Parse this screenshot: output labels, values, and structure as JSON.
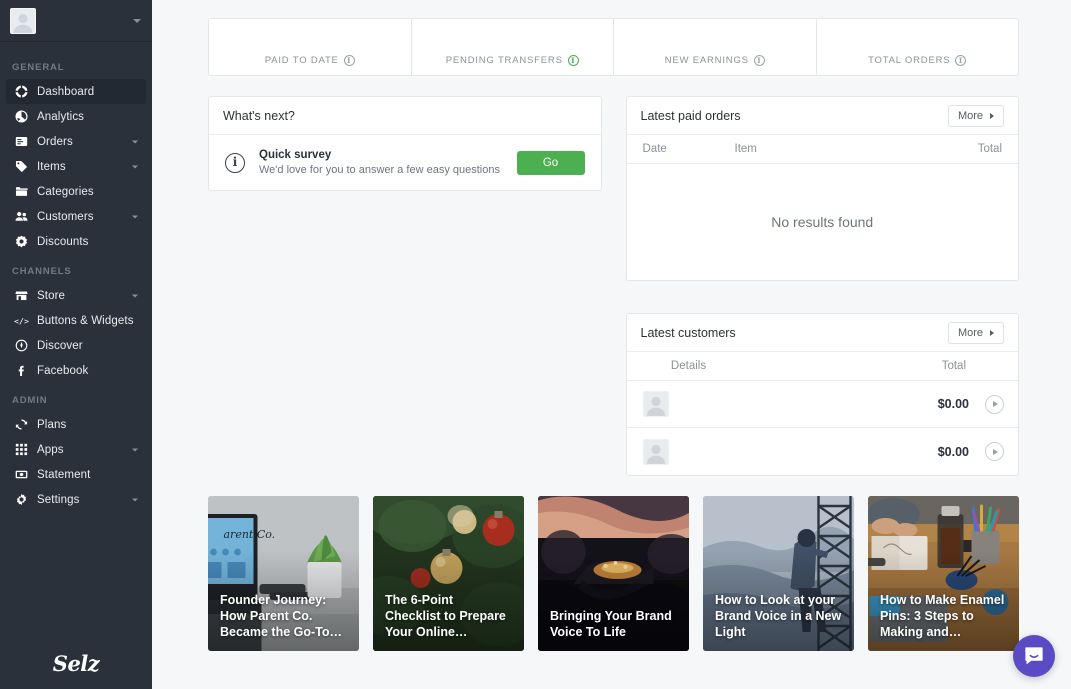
{
  "sidebar": {
    "account": {
      "avatar_alt": "user-avatar",
      "caret": "chevron-down-icon"
    },
    "logo": "Selz",
    "groups": [
      {
        "label": "GENERAL",
        "items": [
          {
            "label": "Dashboard",
            "icon": "dashboard-icon",
            "active": true,
            "expandable": false
          },
          {
            "label": "Analytics",
            "icon": "analytics-icon",
            "active": false,
            "expandable": false
          },
          {
            "label": "Orders",
            "icon": "orders-icon",
            "active": false,
            "expandable": true
          },
          {
            "label": "Items",
            "icon": "tag-icon",
            "active": false,
            "expandable": true
          },
          {
            "label": "Categories",
            "icon": "folder-icon",
            "active": false,
            "expandable": false
          },
          {
            "label": "Customers",
            "icon": "customers-icon",
            "active": false,
            "expandable": true
          },
          {
            "label": "Discounts",
            "icon": "discount-icon",
            "active": false,
            "expandable": false
          }
        ]
      },
      {
        "label": "CHANNELS",
        "items": [
          {
            "label": "Store",
            "icon": "store-icon",
            "active": false,
            "expandable": true
          },
          {
            "label": "Buttons & Widgets",
            "icon": "code-icon",
            "active": false,
            "expandable": false
          },
          {
            "label": "Discover",
            "icon": "discover-icon",
            "active": false,
            "expandable": false
          },
          {
            "label": "Facebook",
            "icon": "facebook-icon",
            "active": false,
            "expandable": false
          }
        ]
      },
      {
        "label": "ADMIN",
        "items": [
          {
            "label": "Plans",
            "icon": "plans-icon",
            "active": false,
            "expandable": false
          },
          {
            "label": "Apps",
            "icon": "apps-icon",
            "active": false,
            "expandable": true
          },
          {
            "label": "Statement",
            "icon": "statement-icon",
            "active": false,
            "expandable": false
          },
          {
            "label": "Settings",
            "icon": "gear-icon",
            "active": false,
            "expandable": true
          }
        ]
      }
    ]
  },
  "stats": [
    {
      "label": "PAID TO DATE",
      "value": "",
      "info_icon": "info-icon",
      "info_color": "#9aa3ad"
    },
    {
      "label": "PENDING TRANSFERS",
      "value": "",
      "info_icon": "info-icon",
      "info_color": "#4caf50"
    },
    {
      "label": "NEW EARNINGS",
      "value": "",
      "info_icon": "info-icon",
      "info_color": "#9aa3ad"
    },
    {
      "label": "TOTAL ORDERS",
      "value": "",
      "info_icon": "info-icon",
      "info_color": "#9aa3ad"
    }
  ],
  "whats_next": {
    "title": "What's next?",
    "task": {
      "icon": "info-icon",
      "title": "Quick survey",
      "subtitle": "We'd love for you to answer a few easy questions",
      "action_label": "Go"
    }
  },
  "latest_paid_orders": {
    "title": "Latest paid orders",
    "more_label": "More",
    "columns": {
      "date": "Date",
      "item": "Item",
      "total": "Total"
    },
    "empty_text": "No results found",
    "rows": []
  },
  "latest_customers": {
    "title": "Latest customers",
    "more_label": "More",
    "columns": {
      "details": "Details",
      "total": "Total"
    },
    "rows": [
      {
        "avatar": "user-avatar-placeholder",
        "name": "",
        "total": "$0.00",
        "chevron": "chevron-right-icon"
      },
      {
        "avatar": "user-avatar-placeholder",
        "name": "",
        "total": "$0.00",
        "chevron": "chevron-right-icon"
      }
    ]
  },
  "blog_posts": [
    {
      "title": "Founder Journey: How Parent Co. Became the Go-To…",
      "theme": "desk-laptop-plant"
    },
    {
      "title": "The 6-Point Checklist to Prepare Your Online…",
      "theme": "christmas-ornaments"
    },
    {
      "title": "Bringing Your Brand Voice To Life",
      "theme": "dark-sunset-hands"
    },
    {
      "title": "How to Look at your Brand Voice in a New Light",
      "theme": "tower-person-fog"
    },
    {
      "title": "How to Make Enamel Pins: 3 Steps to Making and…",
      "theme": "desk-coffee-pens"
    }
  ],
  "intercom": {
    "label": "messenger-launcher",
    "color": "#5a4bc4"
  },
  "colors": {
    "sidebar_bg": "#2b313b",
    "page_bg": "#f6f7f8",
    "accent_green": "#4cb050",
    "card_border": "#e3e7ea",
    "text_dark": "#2b313b",
    "text_muted": "#8a929c"
  }
}
